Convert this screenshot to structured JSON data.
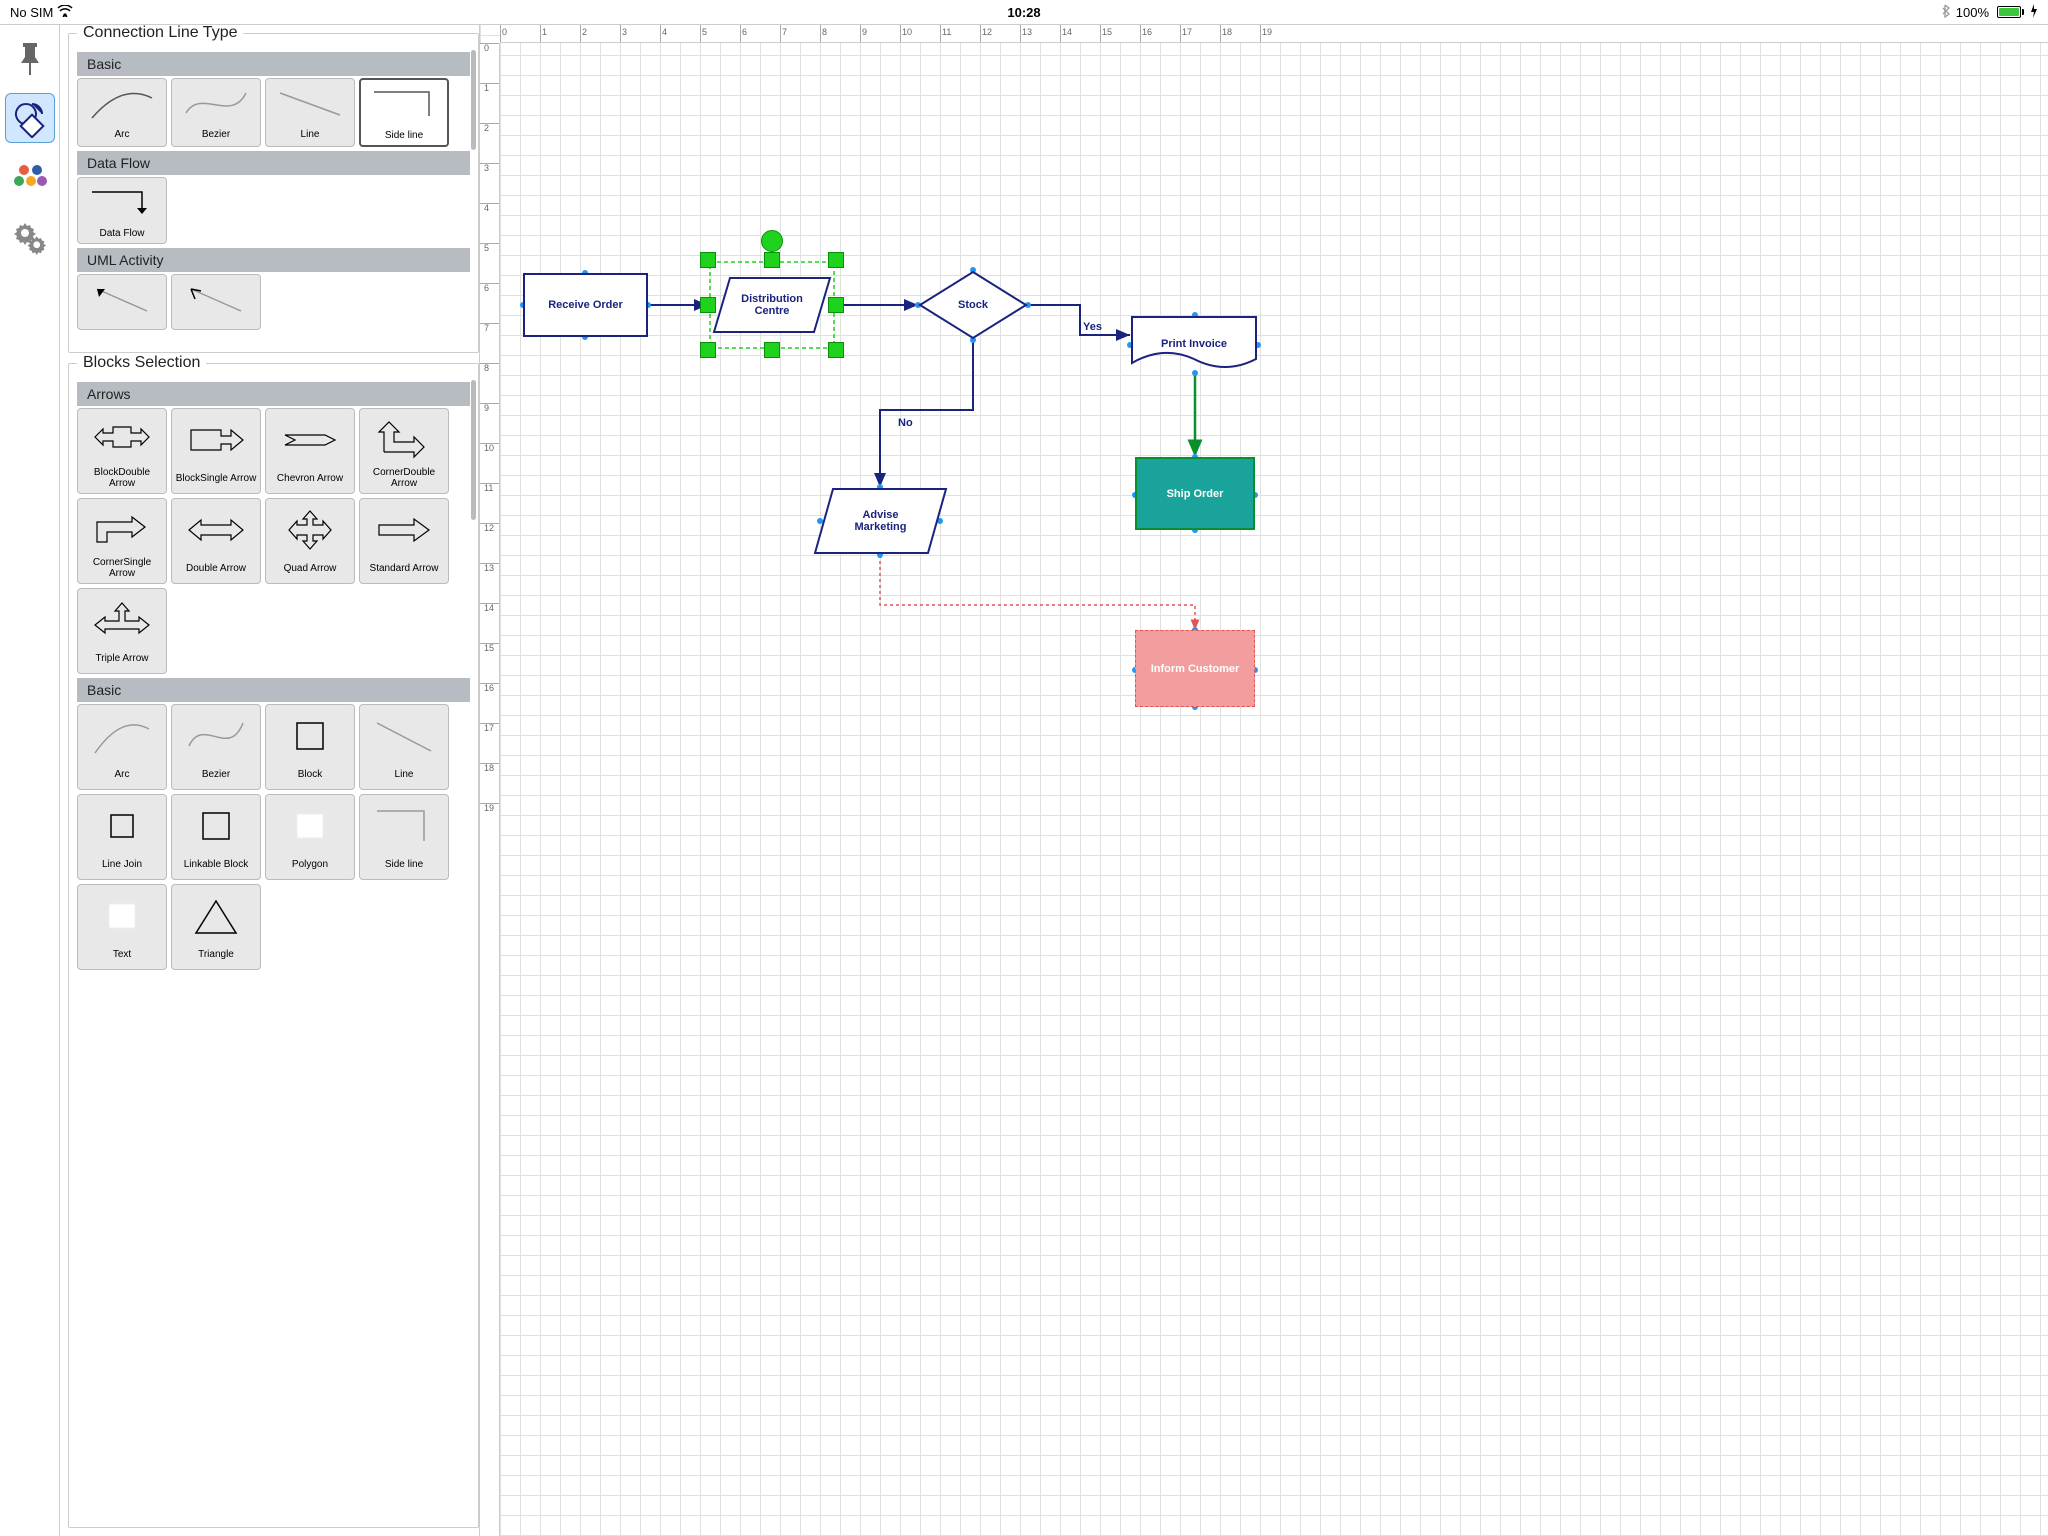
{
  "status": {
    "noSim": "No SIM",
    "time": "10:28",
    "batteryPct": "100%"
  },
  "panels": {
    "connection": {
      "title": "Connection Line Type",
      "sections": [
        {
          "name": "Basic",
          "items": [
            "Arc",
            "Bezier",
            "Line",
            "Side line"
          ]
        },
        {
          "name": "Data Flow",
          "items": [
            "Data Flow"
          ]
        },
        {
          "name": "UML Activity",
          "items": [
            "",
            ""
          ]
        }
      ]
    },
    "blocks": {
      "title": "Blocks Selection",
      "sections": [
        {
          "name": "Arrows",
          "items": [
            "BlockDouble\nArrow",
            "BlockSingle\nArrow",
            "Chevron Arrow",
            "CornerDouble\nArrow",
            "CornerSingle\nArrow",
            "Double Arrow",
            "Quad Arrow",
            "Standard Arrow",
            "Triple Arrow"
          ]
        },
        {
          "name": "Basic",
          "items": [
            "Arc",
            "Bezier",
            "Block",
            "Line",
            "Line Join",
            "Linkable Block",
            "Polygon",
            "Side line",
            "Text",
            "Triangle"
          ]
        }
      ]
    }
  },
  "canvas": {
    "ruler": [
      "0",
      "1",
      "2",
      "3",
      "4",
      "5",
      "6",
      "7",
      "8",
      "9",
      "10",
      "11",
      "12",
      "13",
      "14",
      "15",
      "16",
      "17",
      "18",
      "19"
    ],
    "nodes": {
      "receive": "Receive Order",
      "distribution": "Distribution\nCentre",
      "stock": "Stock",
      "print": "Print Invoice",
      "ship": "Ship Order",
      "advise": "Advise\nMarketing",
      "inform": "Inform Customer"
    },
    "labels": {
      "yes": "Yes",
      "no": "No"
    }
  }
}
